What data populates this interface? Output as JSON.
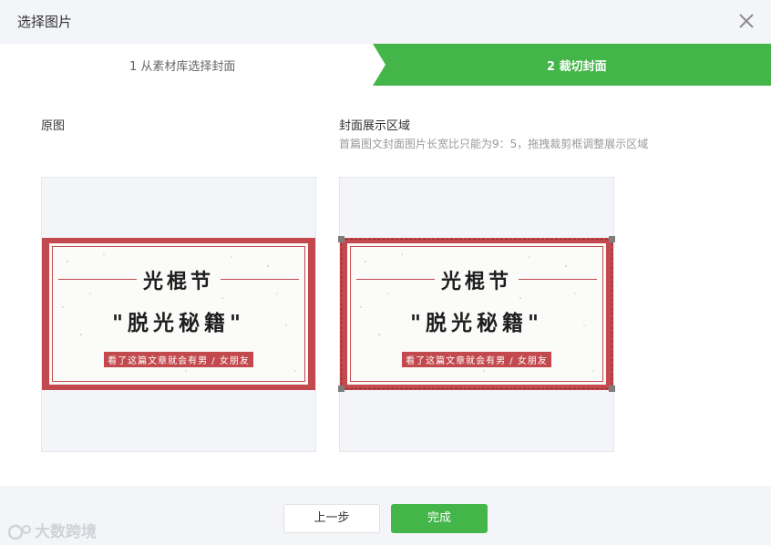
{
  "dialog": {
    "title": "选择图片"
  },
  "steps": [
    {
      "label": "1 从素材库选择封面",
      "active": false
    },
    {
      "label": "2 裁切封面",
      "active": true
    }
  ],
  "original": {
    "label": "原图"
  },
  "display_area": {
    "label": "封面展示区域",
    "hint": "首篇图文封面图片长宽比只能为9：5，拖拽裁剪框调整展示区域"
  },
  "cover": {
    "title": "光棍节",
    "subtitle": "\"脱光秘籍\"",
    "tag": "看了这篇文章就会有男 / 女朋友"
  },
  "footer": {
    "prev_label": "上一步",
    "done_label": "完成"
  },
  "watermark": {
    "text": "大数跨境"
  },
  "colors": {
    "accent_green": "#44b549",
    "cover_red": "#c24a4e",
    "panel_bg": "#f4f5f9"
  },
  "icons": {
    "close": "close-icon"
  }
}
